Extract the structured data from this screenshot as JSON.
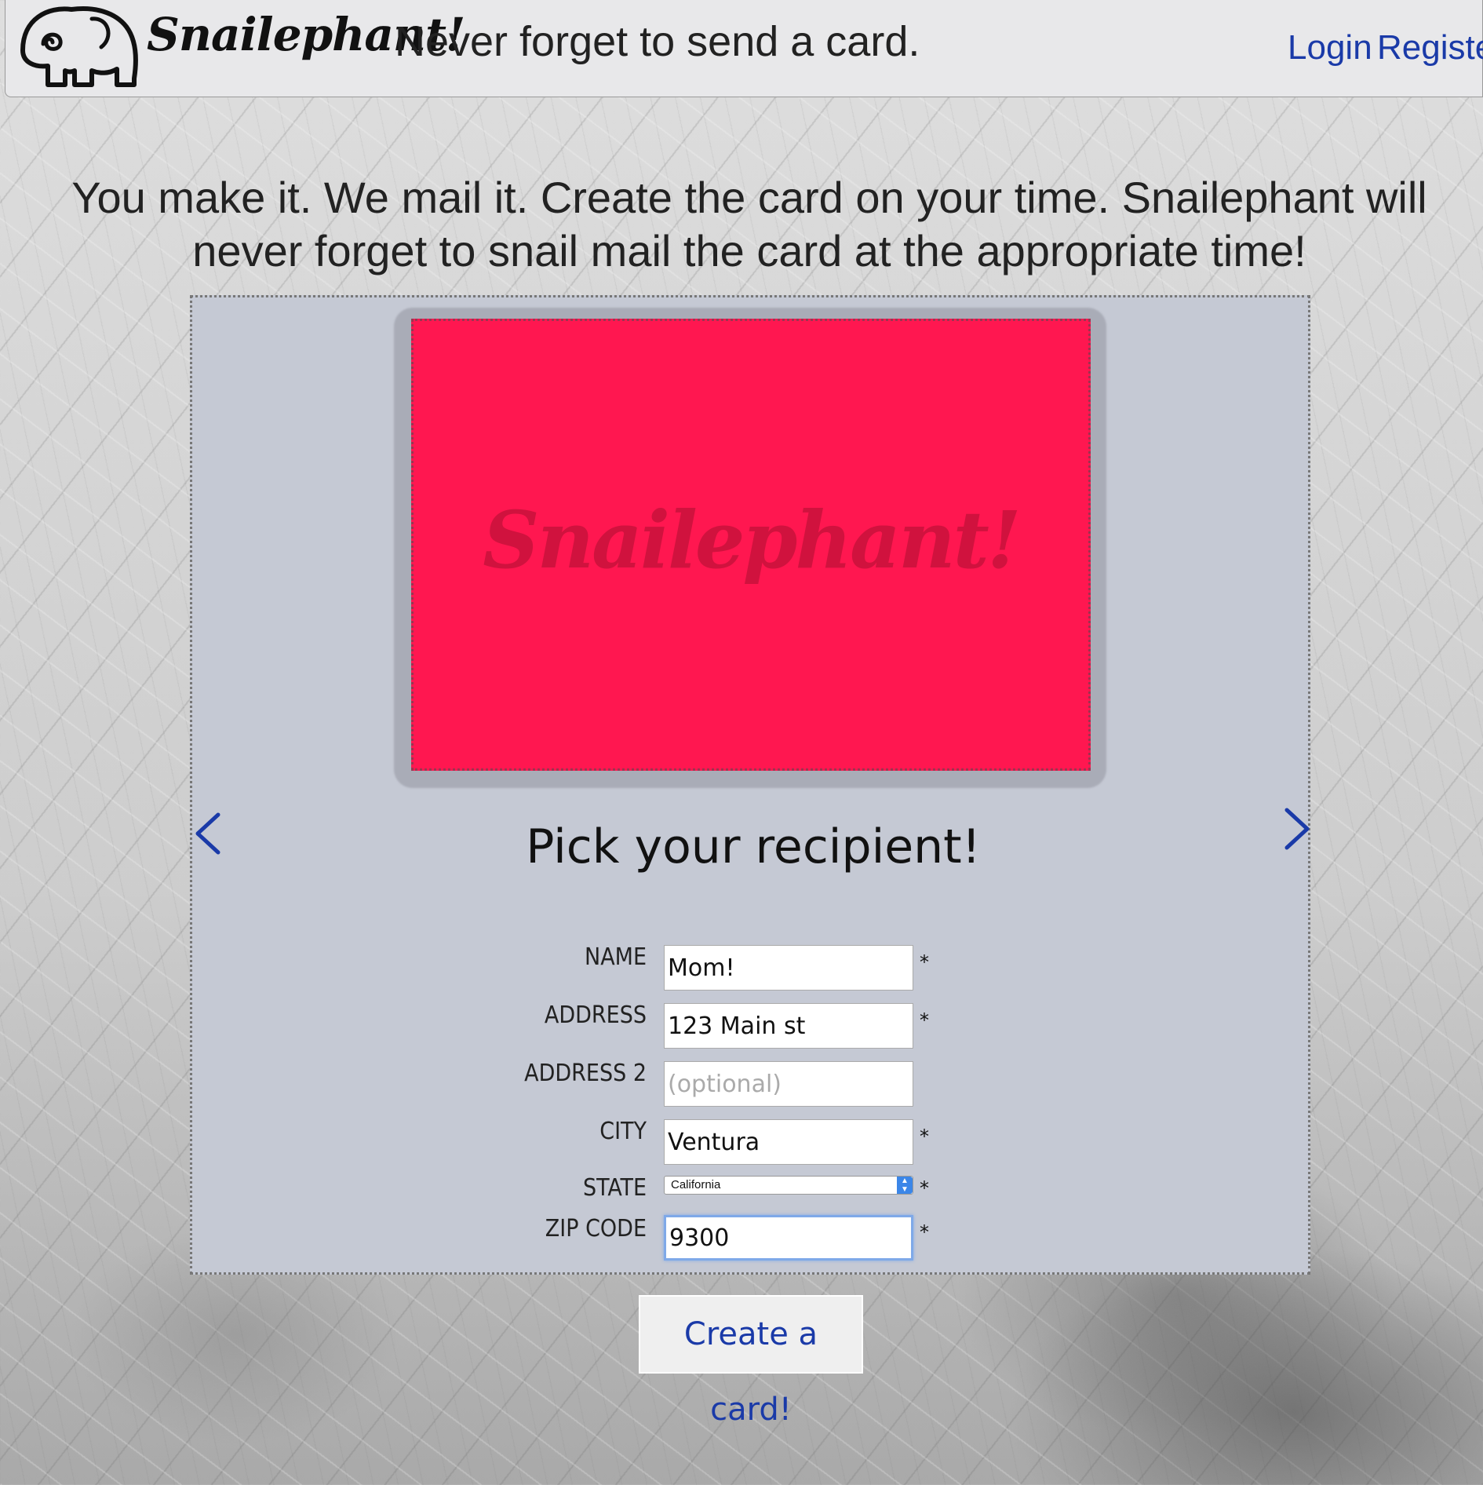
{
  "header": {
    "brand": "Snailephant!",
    "tagline": "Never forget to send a card.",
    "login": "Login",
    "register": "Register"
  },
  "hero": {
    "line1": "You make it. We mail it. Create the card on your time. Snailephant will",
    "line2": "never forget to snail mail the card at the appropriate time!"
  },
  "card": {
    "color": "#ff1750",
    "watermark": "Snailephant!"
  },
  "section_title": "Pick your recipient!",
  "form": {
    "name_label": "NAME",
    "name_value": "Mom!",
    "address_label": "ADDRESS",
    "address_value": "123 Main st",
    "address2_label": "ADDRESS 2",
    "address2_placeholder": "(optional)",
    "city_label": "CITY",
    "city_value": "Ventura",
    "state_label": "STATE",
    "state_value": "California",
    "zip_label": "ZIP CODE",
    "zip_value": "9300",
    "required_mark": "*"
  },
  "icons": {
    "logo": "elephant-logo-icon",
    "prev": "chevron-left-icon",
    "next": "chevron-right-icon",
    "select": "select-updown-icon"
  },
  "colors": {
    "link": "#1a3aa8",
    "panel": "#c5c9d4",
    "focus": "#7fa9e8"
  },
  "actions": {
    "create": "Create a card!"
  }
}
